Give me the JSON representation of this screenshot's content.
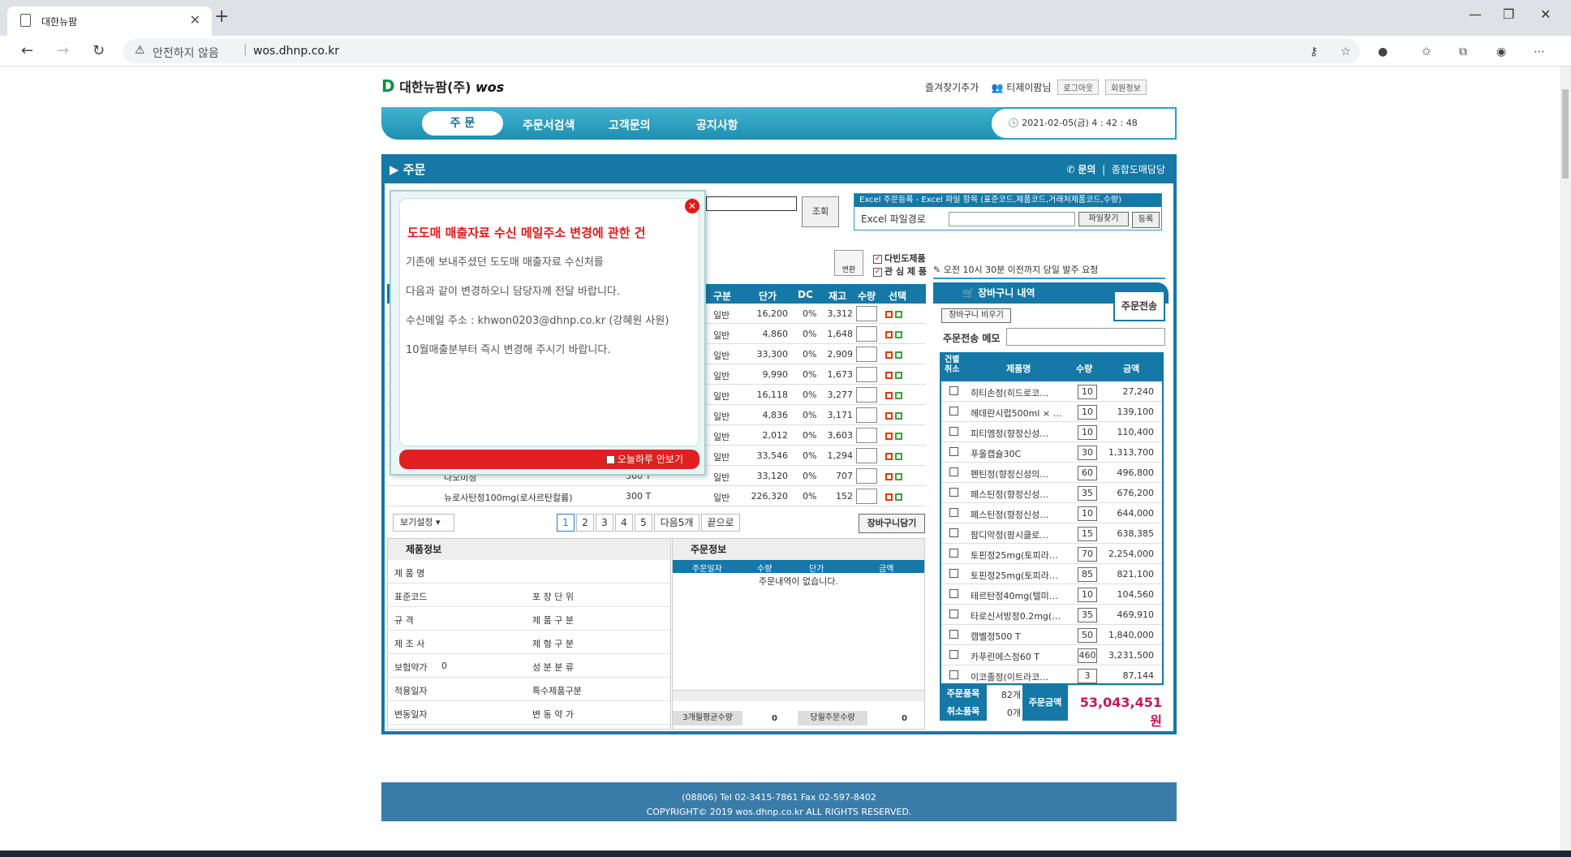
{
  "browser": {
    "tab_title": "대한뉴팜",
    "security": "안전하지 않음",
    "url": "wos.dhnp.co.kr"
  },
  "header": {
    "logo_text": "대한뉴팜(주)",
    "logo_suffix": "wos",
    "favorites": "즐겨찾기추가",
    "user": "티제이팜님",
    "logout": "로그아웃",
    "member_info": "회원정보"
  },
  "gnb": {
    "items": [
      "주 문",
      "주문서검색",
      "고객문의",
      "공지사항"
    ],
    "clock": "2021-02-05(금) 4 : 42 : 48"
  },
  "main": {
    "title": "주문",
    "inquiry": "문의",
    "contact": "종합도매담당"
  },
  "search": {
    "button": "조회"
  },
  "excel": {
    "header": "Excel 주문등록 - Excel 파일 항목 (표준코드,제품코드,거래처제품코드,수량)",
    "path_label": "Excel 파일경로",
    "browse": "파일찾기",
    "register": "등록"
  },
  "options": {
    "convert": "변환",
    "multi": "다빈도제품",
    "interest": "관 심 제 품",
    "notice": "오전 10시 30분 이전까지 당일 발주 요청"
  },
  "product_table": {
    "headers": [
      "구분",
      "단가",
      "DC",
      "재고",
      "수량",
      "선택"
    ],
    "rows": [
      {
        "name": "",
        "spec": "",
        "type": "일반",
        "price": "16,200",
        "dc": "0%",
        "stock": "3,312"
      },
      {
        "name": "",
        "spec": "",
        "type": "일반",
        "price": "4,860",
        "dc": "0%",
        "stock": "1,648"
      },
      {
        "name": "",
        "spec": "",
        "type": "일반",
        "price": "33,300",
        "dc": "0%",
        "stock": "2,909"
      },
      {
        "name": "",
        "spec": "",
        "type": "일반",
        "price": "9,990",
        "dc": "0%",
        "stock": "1,673"
      },
      {
        "name": "",
        "spec": "",
        "type": "일반",
        "price": "16,118",
        "dc": "0%",
        "stock": "3,277"
      },
      {
        "name": "",
        "spec": "",
        "type": "일반",
        "price": "4,836",
        "dc": "0%",
        "stock": "3,171"
      },
      {
        "name": "",
        "spec": "",
        "type": "일반",
        "price": "2,012",
        "dc": "0%",
        "stock": "3,603"
      },
      {
        "name": "",
        "spec": "",
        "type": "일반",
        "price": "33,546",
        "dc": "0%",
        "stock": "1,294"
      },
      {
        "name": "나오미정",
        "spec": "360 T",
        "type": "일반",
        "price": "33,120",
        "dc": "0%",
        "stock": "707"
      },
      {
        "name": "뉴로사탄정100mg(로사르탄칼륨)",
        "spec": "300 T",
        "type": "일반",
        "price": "226,320",
        "dc": "0%",
        "stock": "152"
      }
    ]
  },
  "popup": {
    "title": "도도매 매출자료 수신 메일주소 변경에 관한 건",
    "line1": "기존에 보내주셨던 도도매 매출자료 수신처를",
    "line2": "다음과 같이 변경하오니 담당자께 전달 바랍니다.",
    "line3": "수신메일 주소 : khwon0203@dhnp.co.kr (강혜원 사원)",
    "line4": "10월매출분부터 즉시 변경해 주시기 바랍니다.",
    "no_today": "오늘하루 안보기"
  },
  "pager": {
    "view": "보기설정",
    "pages": [
      "1",
      "2",
      "3",
      "4",
      "5"
    ],
    "next5": "다음5개",
    "last": "끝으로",
    "add_cart": "장바구니담기"
  },
  "product_info": {
    "title": "제품정보",
    "name_l": "제 품 명",
    "code_l": "표준코드",
    "pack_l": "포 장 단 위",
    "spec_l": "규 격",
    "kind_l": "제 품 구 분",
    "maker_l": "제 조 사",
    "form_l": "제 형 구 분",
    "ins_l": "보험약가",
    "ins_v": "0",
    "ing_l": "성 분 분 류",
    "apply_l": "적용일자",
    "special_l": "특수제품구분",
    "chg_l": "변동일자",
    "chgp_l": "변 동 약 가"
  },
  "order_info": {
    "title": "주문정보",
    "headers": [
      "주문일자",
      "수량",
      "단가",
      "금액"
    ],
    "empty": "주문내역이 없습니다.",
    "avg3_l": "3개월평균수량",
    "avg3_v": "0",
    "month_l": "당월주문수량",
    "month_v": "0"
  },
  "cart": {
    "title": "장바구니 내역",
    "send": "주문전송",
    "empty": "장바구니 비우기",
    "memo": "주문전송 메모",
    "headers": [
      "건별취소",
      "제품명",
      "수량",
      "금액"
    ],
    "rows": [
      {
        "name": "히티손정(히드로코…",
        "qty": "10",
        "amt": "27,240"
      },
      {
        "name": "헤데란시럽500ml × …",
        "qty": "10",
        "amt": "139,100"
      },
      {
        "name": "피티엠정(향정신성…",
        "qty": "10",
        "amt": "110,400"
      },
      {
        "name": "푸올캡슐30C",
        "qty": "30",
        "amt": "1,313,700"
      },
      {
        "name": "펜틴정(향정신성의…",
        "qty": "60",
        "amt": "496,800"
      },
      {
        "name": "페스틴정(향정신성…",
        "qty": "35",
        "amt": "676,200"
      },
      {
        "name": "페스틴정(향정신성…",
        "qty": "10",
        "amt": "644,000"
      },
      {
        "name": "팜디악정(팜시클로…",
        "qty": "15",
        "amt": "638,385"
      },
      {
        "name": "토핀정25mg(토피라…",
        "qty": "70",
        "amt": "2,254,000"
      },
      {
        "name": "토핀정25mg(토피라…",
        "qty": "85",
        "amt": "821,100"
      },
      {
        "name": "테르탄정40mg(텔미…",
        "qty": "10",
        "amt": "104,560"
      },
      {
        "name": "타로신서방정0.2mg(…",
        "qty": "35",
        "amt": "469,910"
      },
      {
        "name": "캠벨정500 T",
        "qty": "50",
        "amt": "1,840,000"
      },
      {
        "name": "카푸린에스정60 T",
        "qty": "460",
        "amt": "3,231,500"
      },
      {
        "name": "이코졸정(이트라코…",
        "qty": "3",
        "amt": "87,144"
      }
    ],
    "items_l": "주문품목",
    "items_v": "82개",
    "cancel_l": "취소품목",
    "cancel_v": "0개",
    "total_l": "주문금액",
    "total_v": "53,043,451원"
  },
  "footer": {
    "line1": "(08806)  Tel 02-3415-7861  Fax 02-597-8402",
    "line2": "COPYRIGHT© 2019 wos.dhnp.co.kr ALL RIGHTS RESERVED."
  }
}
